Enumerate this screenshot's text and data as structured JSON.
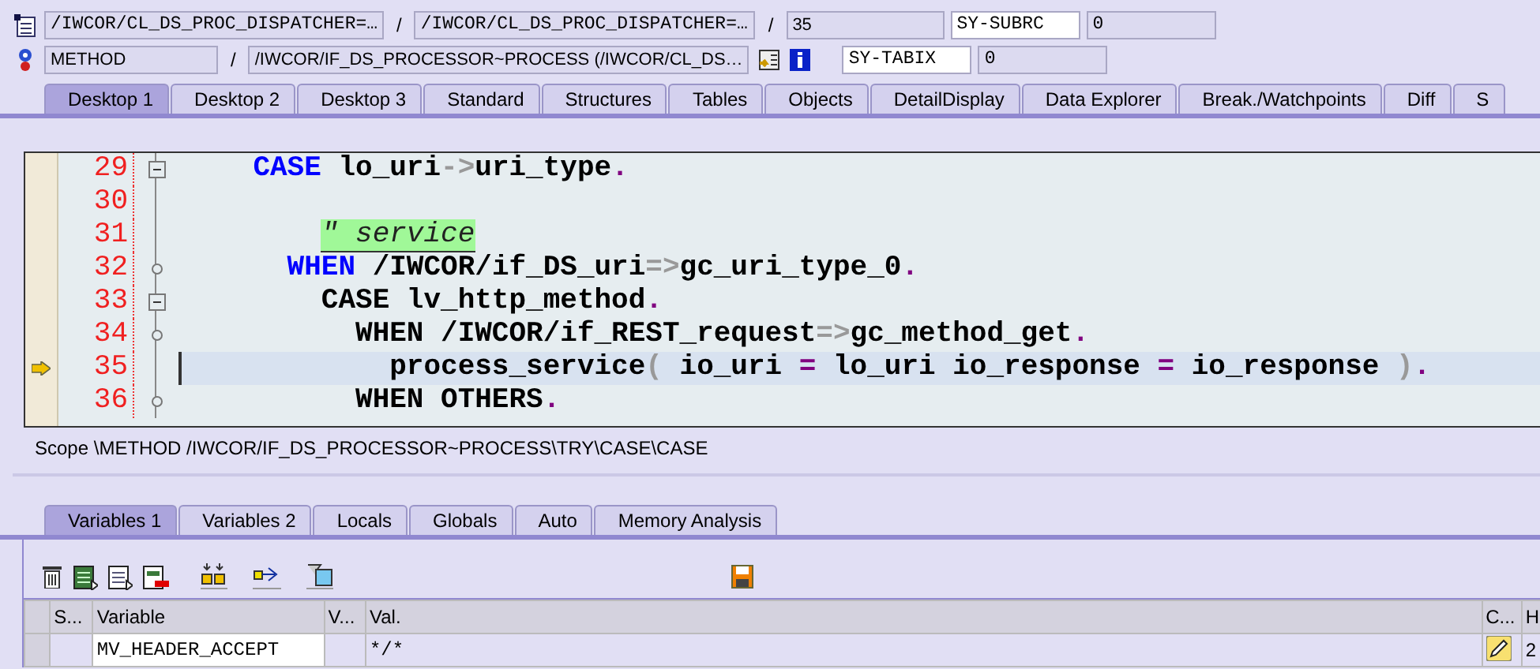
{
  "header": {
    "rows": [
      {
        "items": [
          {
            "kind": "code_field",
            "text": "/IWCOR/CL_DS_PROC_DISPATCHER=…"
          },
          {
            "kind": "sep",
            "text": "/"
          },
          {
            "kind": "code_field",
            "text": "/IWCOR/CL_DS_PROC_DISPATCHER=…"
          },
          {
            "kind": "sep",
            "text": "/"
          },
          {
            "kind": "field",
            "text": "35"
          },
          {
            "kind": "key_field",
            "text": "SY-SUBRC"
          },
          {
            "kind": "code_field",
            "text": "0"
          }
        ]
      },
      {
        "items": [
          {
            "kind": "field",
            "text": "METHOD"
          },
          {
            "kind": "sep",
            "text": "/"
          },
          {
            "kind": "field",
            "text": "/IWCOR/IF_DS_PROCESSOR~PROCESS (/IWCOR/CL_DS…"
          },
          {
            "kind": "key_field",
            "text": "SY-TABIX"
          },
          {
            "kind": "code_field",
            "text": "0"
          }
        ]
      }
    ]
  },
  "desktop_tabs": [
    {
      "label": "Desktop 1",
      "selected": true
    },
    {
      "label": "Desktop 2",
      "selected": false
    },
    {
      "label": "Desktop 3",
      "selected": false
    },
    {
      "label": "Standard",
      "selected": false
    },
    {
      "label": "Structures",
      "selected": false
    },
    {
      "label": "Tables",
      "selected": false
    },
    {
      "label": "Objects",
      "selected": false
    },
    {
      "label": "DetailDisplay",
      "selected": false
    },
    {
      "label": "Data Explorer",
      "selected": false
    },
    {
      "label": "Break./Watchpoints",
      "selected": false
    },
    {
      "label": "Diff",
      "selected": false
    },
    {
      "label": "S",
      "selected": false
    }
  ],
  "editor": {
    "lines": [
      {
        "number": "29",
        "kind": "fold_start",
        "current": false,
        "tokens": [
          {
            "kind": "keyword",
            "text": "    CASE"
          },
          {
            "kind": "text",
            "text": " lo_uri"
          },
          {
            "kind": "op",
            "text": "->"
          },
          {
            "kind": "text",
            "text": "uri_type"
          },
          {
            "kind": "punct",
            "text": "."
          }
        ]
      },
      {
        "number": "30",
        "kind": "plain",
        "current": false
      },
      {
        "number": "31",
        "kind": "plain",
        "current": false,
        "tokens": [
          {
            "kind": "comment",
            "text": "        \" service"
          }
        ]
      },
      {
        "number": "32",
        "kind": "fold_branch",
        "current": false,
        "tokens": [
          {
            "kind": "keyword",
            "text": "      WHEN"
          },
          {
            "kind": "text",
            "text": " /IWCOR/if_DS_uri"
          },
          {
            "kind": "op",
            "text": "=>"
          },
          {
            "kind": "text",
            "text": "gc_uri_type_0"
          },
          {
            "kind": "punct",
            "text": "."
          }
        ]
      },
      {
        "number": "33",
        "kind": "fold_start",
        "current": false,
        "tokens": [
          {
            "kind": "text",
            "text": "        CASE lv_http_method"
          },
          {
            "kind": "punct",
            "text": "."
          }
        ]
      },
      {
        "number": "34",
        "kind": "fold_branch",
        "current": false,
        "tokens": [
          {
            "kind": "text",
            "text": "          WHEN /IWCOR/if_REST_request"
          },
          {
            "kind": "op",
            "text": "=>"
          },
          {
            "kind": "text",
            "text": "gc_method_get"
          },
          {
            "kind": "punct",
            "text": "."
          }
        ]
      },
      {
        "number": "35",
        "kind": "plain",
        "current": true,
        "tokens": [
          {
            "kind": "text",
            "text": "            process_service"
          },
          {
            "kind": "op",
            "text": "("
          },
          {
            "kind": "text",
            "text": " io_uri "
          },
          {
            "kind": "punct",
            "text": "="
          },
          {
            "kind": "text",
            "text": " lo_uri io_response "
          },
          {
            "kind": "punct",
            "text": "="
          },
          {
            "kind": "text",
            "text": " io_response "
          },
          {
            "kind": "op",
            "text": ")"
          },
          {
            "kind": "punct",
            "text": "."
          }
        ]
      },
      {
        "number": "36",
        "kind": "fold_branch",
        "current": false,
        "tokens": [
          {
            "kind": "text",
            "text": "          WHEN OTHERS"
          },
          {
            "kind": "punct",
            "text": "."
          }
        ]
      }
    ]
  },
  "scope": "Scope \\METHOD /IWCOR/IF_DS_PROCESSOR~PROCESS\\TRY\\CASE\\CASE",
  "variable_tabs": [
    {
      "label": "Variables 1",
      "selected": true
    },
    {
      "label": "Variables 2",
      "selected": false
    },
    {
      "label": "Locals",
      "selected": false
    },
    {
      "label": "Globals",
      "selected": false
    },
    {
      "label": "Auto",
      "selected": false
    },
    {
      "label": "Memory Analysis",
      "selected": false
    }
  ],
  "variables": {
    "columns": [
      "S...",
      "Variable",
      "V...",
      "Val.",
      "C...",
      "H"
    ],
    "rows": [
      {
        "cells": [
          "",
          "MV_HEADER_ACCEPT",
          "",
          "*/*",
          "",
          "2"
        ]
      }
    ]
  }
}
